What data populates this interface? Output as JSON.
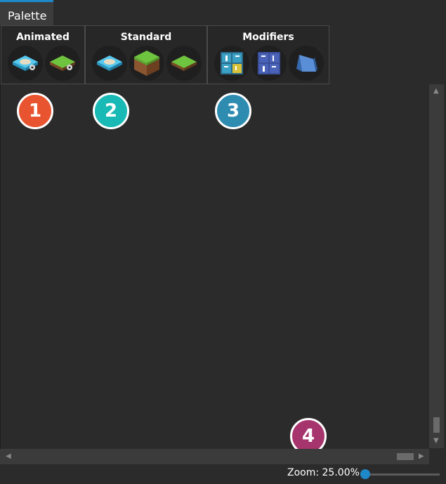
{
  "tab": {
    "label": "Palette"
  },
  "groups": [
    {
      "title": "Animated",
      "tiles": [
        "water-tile-anim-icon",
        "grass-tile-anim-icon"
      ]
    },
    {
      "title": "Standard",
      "tiles": [
        "water-tile-icon",
        "grass-block-icon",
        "grass-tile-icon"
      ]
    },
    {
      "title": "Modifiers",
      "tiles": [
        "tile-numbers-icon",
        "tile-numbers-rotated-icon",
        "slope-block-icon"
      ]
    }
  ],
  "badges": [
    {
      "label": "1",
      "color": "#e8542f"
    },
    {
      "label": "2",
      "color": "#19b9b5"
    },
    {
      "label": "3",
      "color": "#2f8cb1"
    },
    {
      "label": "4",
      "color": "#a7356d"
    }
  ],
  "status": {
    "zoom_label": "Zoom: 25.00%",
    "zoom_fraction": 0.0
  },
  "colors": {
    "accent": "#1e88c8",
    "background": "#2b2b2b",
    "group_background": "#272727"
  }
}
